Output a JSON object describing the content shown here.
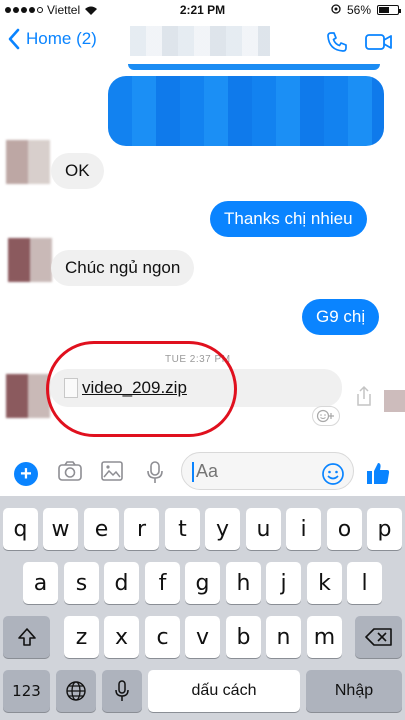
{
  "status_bar": {
    "carrier": "Viettel",
    "time": "2:21 PM",
    "battery": "56%",
    "battery_level": 0.56
  },
  "nav": {
    "back_label": "Home (2)"
  },
  "messages": [
    {
      "dir": "in",
      "text": "OK"
    },
    {
      "dir": "out",
      "text": "Thanks chị nhieu"
    },
    {
      "dir": "in",
      "text": "Chúc ngủ ngon"
    },
    {
      "dir": "out",
      "text": "G9 chị"
    }
  ],
  "timestamp": "TUE 2:37 PM",
  "file": {
    "name": "video_209.zip"
  },
  "composer": {
    "placeholder": "Aa"
  },
  "keyboard": {
    "row1": [
      "q",
      "w",
      "e",
      "r",
      "t",
      "y",
      "u",
      "i",
      "o",
      "p"
    ],
    "row2": [
      "a",
      "s",
      "d",
      "f",
      "g",
      "h",
      "j",
      "k",
      "l"
    ],
    "row3": [
      "z",
      "x",
      "c",
      "v",
      "b",
      "n",
      "m"
    ],
    "numbers_key": "123",
    "space_label": "dấu cách",
    "enter_label": "Nhập"
  },
  "colors": {
    "accent": "#0a84ff",
    "highlight": "#e0101e",
    "incoming_bubble": "#f0f0f0",
    "keyboard_bg": "#d1d4da"
  }
}
